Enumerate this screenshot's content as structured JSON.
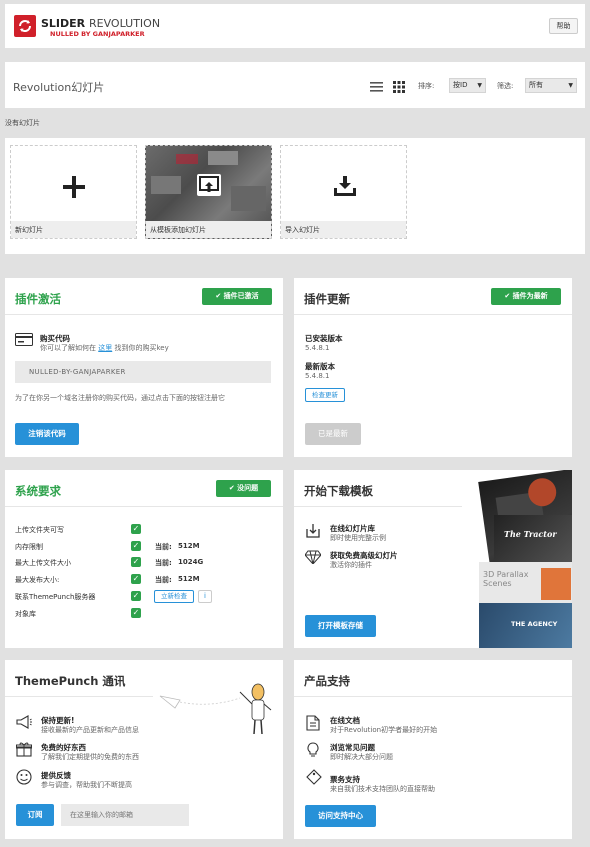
{
  "header": {
    "logo_main": "SLIDER",
    "logo_sub": "REVOLUTION",
    "logo_tag": "NULLED BY GANJAPARKER",
    "help_label": "帮助"
  },
  "toolbar": {
    "title": "Revolution幻灯片",
    "sort_label": "排序:",
    "sort_value": "按ID",
    "filter_label": "筛选:",
    "filter_value": "所有"
  },
  "no_sliders": "没有幻灯片",
  "cards": [
    {
      "label": "新幻灯片"
    },
    {
      "label": "从模板添加幻灯片"
    },
    {
      "label": "导入幻灯片"
    }
  ],
  "activation": {
    "title": "插件激活",
    "badge": "插件已激活",
    "code_title": "购买代码",
    "code_desc_pre": "你可以了解如何在",
    "code_desc_link": "这里",
    "code_desc_post": "找到你的购买key",
    "code_value": "NULLED-BY-GANJAPARKER",
    "note": "为了在你另一个域名注册你的购买代码，通过点击下面的按钮注册它",
    "button": "注销该代码"
  },
  "update": {
    "title": "插件更新",
    "badge": "插件为最新",
    "installed_label": "已安装版本",
    "installed_value": "5.4.8.1",
    "latest_label": "最新版本",
    "latest_value": "5.4.8.1",
    "check_button": "检查更新",
    "updated_button": "已是最新"
  },
  "requirements": {
    "title": "系统要求",
    "badge": "没问题",
    "rows": [
      {
        "label": "上传文件夹可写",
        "current": "",
        "value": ""
      },
      {
        "label": "内存限制",
        "current": "当前:",
        "value": "512M"
      },
      {
        "label": "最大上传文件大小",
        "current": "当前:",
        "value": "1024G"
      },
      {
        "label": "最大发布大小:",
        "current": "当前:",
        "value": "512M"
      },
      {
        "label": "联系ThemePunch服务器",
        "current": "",
        "value": ""
      },
      {
        "label": "对象库",
        "current": "",
        "value": ""
      }
    ],
    "check_now": "立新检查",
    "info": "i"
  },
  "templates": {
    "title": "开始下载模板",
    "items": [
      {
        "title": "在线幻灯片库",
        "desc": "即时使用完整示例"
      },
      {
        "title": "获取免费高级幻灯片",
        "desc": "激活你的插件"
      }
    ],
    "button": "打开模板存储",
    "thumb_text_1": "The Tractor",
    "thumb_text_2": "3D Parallax Scenes",
    "thumb_text_3": "THE AGENCY"
  },
  "newsletter": {
    "title": "ThemePunch 通讯",
    "items": [
      {
        "title": "保持更新!",
        "desc": "接收最新的产品更新和产品信息"
      },
      {
        "title": "免费的好东西",
        "desc": "了解我们定期提供的免费的东西"
      },
      {
        "title": "提供反馈",
        "desc": "参与调查，帮助我们不断提高"
      }
    ],
    "subscribe_button": "订阅",
    "email_placeholder": "在这里输入你的邮箱"
  },
  "support": {
    "title": "产品支持",
    "items": [
      {
        "title": "在线文档",
        "desc": "对于Revolution初学者最好的开始"
      },
      {
        "title": "浏览常见问题",
        "desc": "即时解决大部分问题"
      },
      {
        "title": "票务支持",
        "desc": "来自我们技术支持团队的直接帮助"
      }
    ],
    "button": "访问支持中心"
  },
  "colors": {
    "green": "#2ea24c",
    "blue": "#2791d8",
    "logo_red": "#d0202a"
  }
}
